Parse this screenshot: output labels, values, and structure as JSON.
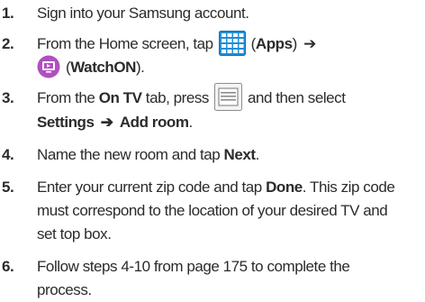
{
  "colors": {
    "text": "#2b2b2b",
    "apps_icon_blue": "#1f8fd6",
    "watchon_icon_purple": "#b14fc1",
    "menu_icon_gray": "#8c8c8c"
  },
  "icons": {
    "apps": "apps-grid-icon",
    "watchon": "watchon-tv-icon",
    "menu": "menu-key-icon",
    "arrow": "right-arrow"
  },
  "steps": [
    {
      "num": "1.",
      "text": "Sign into your Samsung account."
    },
    {
      "num": "2.",
      "pre": "From the Home screen, tap",
      "apps_label": "Apps",
      "arrow": "➔",
      "watchon_label": "WatchON"
    },
    {
      "num": "3.",
      "pre": "From the",
      "tab_label": "On TV",
      "mid": "tab, press",
      "post": "and then select",
      "settings_label": "Settings",
      "arrow": "➔",
      "add_room_label": "Add room"
    },
    {
      "num": "4.",
      "pre": "Name the new room and tap",
      "next_label": "Next"
    },
    {
      "num": "5.",
      "pre": "Enter your current zip code and tap",
      "done_label": "Done",
      "line1_post": ". This zip code",
      "line2": "must correspond to the location of your desired TV and",
      "line3": "set top box."
    },
    {
      "num": "6.",
      "line1": "Follow steps 4-10 from page 175 to complete the",
      "line2": "process."
    }
  ]
}
